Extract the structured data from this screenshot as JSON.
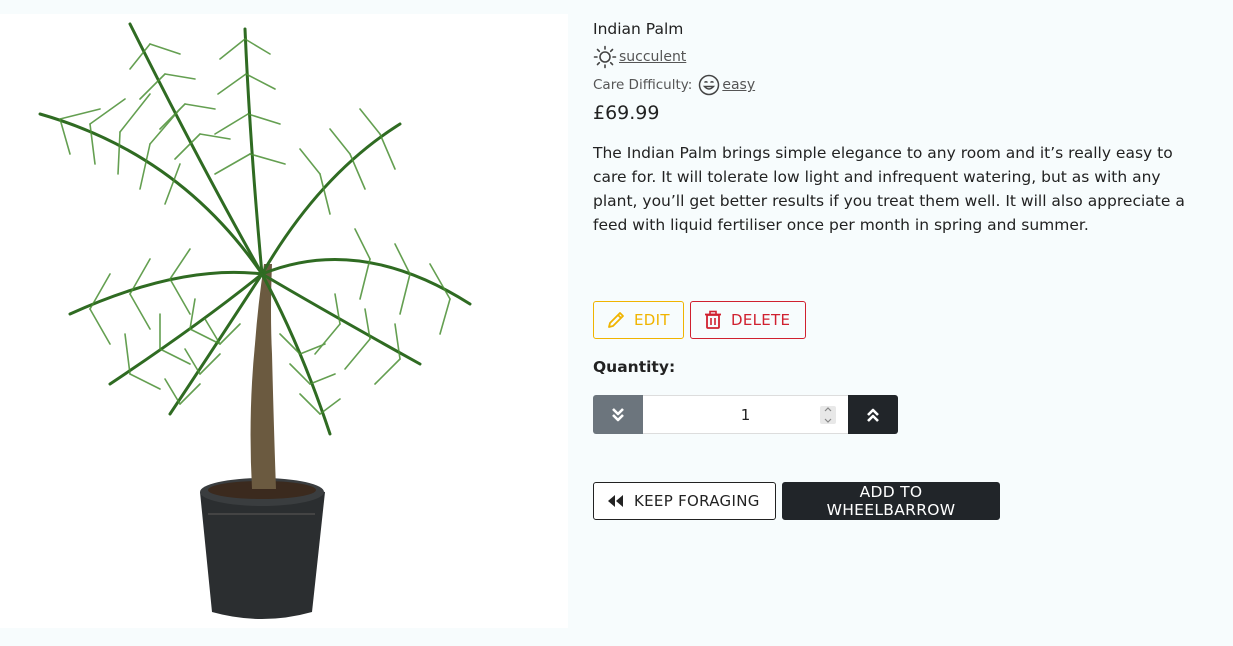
{
  "product": {
    "name": "Indian Palm",
    "category": "succulent",
    "care_difficulty_label": "Care Difficulty:",
    "care_difficulty": "easy",
    "price": "£69.99",
    "description": "The Indian Palm brings simple elegance to any room and it’s really easy to care for. It will tolerate low light and infrequent watering, but as with any plant, you’ll get better results if you treat them well. It will also appreciate a feed with liquid fertiliser once per month in spring and summer."
  },
  "admin": {
    "edit_label": "EDIT",
    "delete_label": "DELETE"
  },
  "quantity": {
    "label": "Quantity:",
    "value": "1"
  },
  "actions": {
    "keep_foraging_label": "KEEP FORAGING",
    "add_label": "ADD TO WHEELBARROW"
  },
  "icons": {
    "category": "sun-icon",
    "difficulty": "smile-icon",
    "edit": "pencil-icon",
    "delete": "trash-icon",
    "decrement": "chevrons-down-icon",
    "increment": "chevrons-up-icon",
    "keep_foraging": "backward-icon"
  },
  "colors": {
    "edit": "#f0b400",
    "delete": "#d0202f",
    "primary_dark": "#212529",
    "secondary": "#6c757d"
  }
}
